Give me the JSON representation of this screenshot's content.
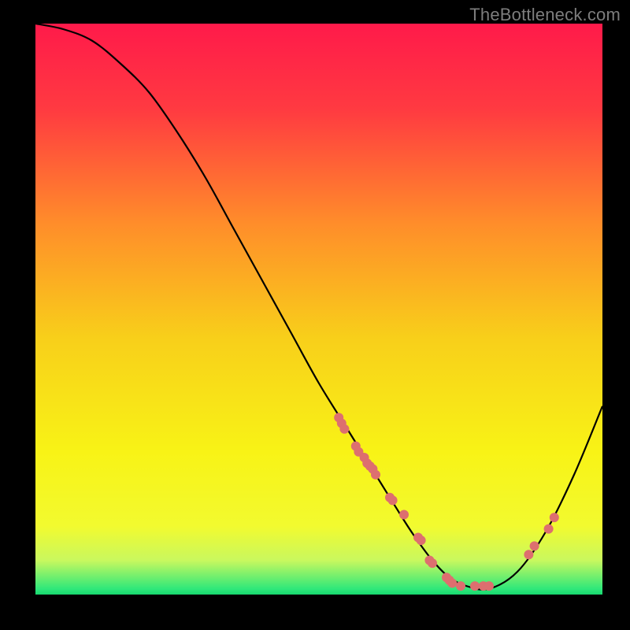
{
  "attribution": "TheBottleneck.com",
  "chart_data": {
    "type": "line",
    "title": "",
    "xlabel": "",
    "ylabel": "",
    "xlim": [
      0,
      100
    ],
    "ylim": [
      0,
      100
    ],
    "x": [
      0,
      5,
      10,
      15,
      20,
      25,
      30,
      35,
      40,
      45,
      50,
      55,
      60,
      65,
      67,
      70,
      73,
      76,
      80,
      85,
      90,
      95,
      100
    ],
    "values": [
      100,
      99,
      97,
      93,
      88,
      81,
      73,
      64,
      55,
      46,
      37,
      29,
      21,
      13,
      10,
      6,
      3,
      1.5,
      1,
      4,
      11,
      21,
      33
    ],
    "dots_x": [
      53.5,
      54.0,
      54.5,
      56.5,
      57.0,
      58.0,
      58.5,
      59.0,
      59.5,
      60.0,
      62.5,
      63.0,
      65.0,
      67.5,
      68.0,
      69.5,
      70.0,
      72.5,
      73.0,
      73.5,
      75.0,
      77.5,
      79.0,
      80.0,
      87.0,
      88.0,
      90.5,
      91.5
    ],
    "dots_y": [
      31.0,
      30.0,
      29.0,
      26.0,
      25.0,
      24.0,
      23.0,
      22.5,
      22.0,
      21.0,
      17.0,
      16.5,
      14.0,
      10.0,
      9.5,
      6.0,
      5.5,
      3.0,
      2.5,
      2.0,
      1.5,
      1.5,
      1.5,
      1.5,
      7.0,
      8.5,
      11.5,
      13.5
    ],
    "gradient_stops": [
      {
        "offset": 0,
        "color": "#ff1a4a"
      },
      {
        "offset": 15,
        "color": "#ff3a41"
      },
      {
        "offset": 35,
        "color": "#ff8d2a"
      },
      {
        "offset": 55,
        "color": "#f8cf1a"
      },
      {
        "offset": 75,
        "color": "#f8f316"
      },
      {
        "offset": 88,
        "color": "#f2fa2f"
      },
      {
        "offset": 94,
        "color": "#c9f85e"
      },
      {
        "offset": 99,
        "color": "#2fe87a"
      },
      {
        "offset": 100,
        "color": "#17d86f"
      }
    ],
    "dot_color": "#dd6f6f",
    "curve_color": "#000000"
  }
}
